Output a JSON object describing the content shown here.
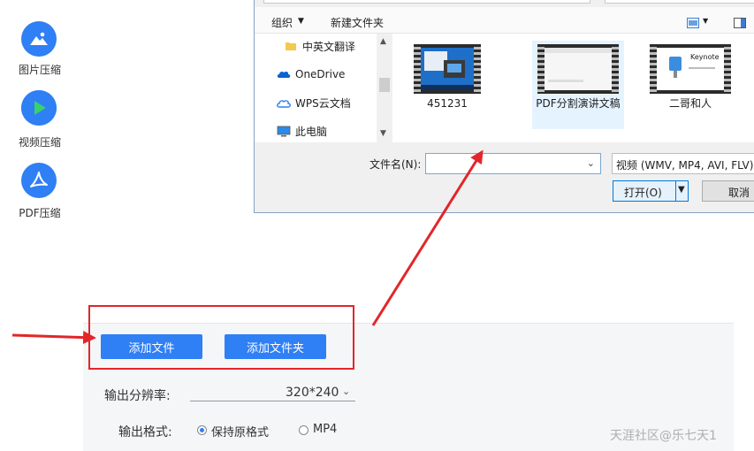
{
  "sidebar": {
    "items": [
      {
        "label": "图片压缩",
        "icon": "image-icon"
      },
      {
        "label": "视频压缩",
        "icon": "play-icon"
      },
      {
        "label": "PDF压缩",
        "icon": "pdf-icon"
      }
    ]
  },
  "main": {
    "add_file_label": "添加文件",
    "add_folder_label": "添加文件夹",
    "resolution_label": "输出分辨率:",
    "resolution_value": "320*240",
    "format_label": "输出格式:",
    "format_options": [
      {
        "label": "保持原格式",
        "selected": true
      },
      {
        "label": "MP4",
        "selected": false
      }
    ]
  },
  "dialog": {
    "toolbar": {
      "organize": "组织",
      "new_folder": "新建文件夹"
    },
    "nav_items": [
      {
        "label": "中英文翻译",
        "icon": "folder-icon"
      },
      {
        "label": "OneDrive",
        "icon": "cloud-icon"
      },
      {
        "label": "WPS云文档",
        "icon": "wps-cloud-icon"
      },
      {
        "label": "此电脑",
        "icon": "computer-icon"
      }
    ],
    "files": [
      {
        "name": "451231",
        "selected": false
      },
      {
        "name": "PDF分割演讲文稿",
        "selected": true
      },
      {
        "name": "二哥和人",
        "selected": false
      }
    ],
    "thumbnail_text": {
      "keynote": "Keynote"
    },
    "filename_label": "文件名(N):",
    "filename_value": "",
    "filetype_value": "视频 (WMV, MP4, AVI, FLV)",
    "open_label": "打开(O)",
    "cancel_label": "取消"
  },
  "watermark": "天涯社区@乐七天1",
  "colors": {
    "accent": "#2f7ff5",
    "annotation_red": "#e2262a"
  }
}
